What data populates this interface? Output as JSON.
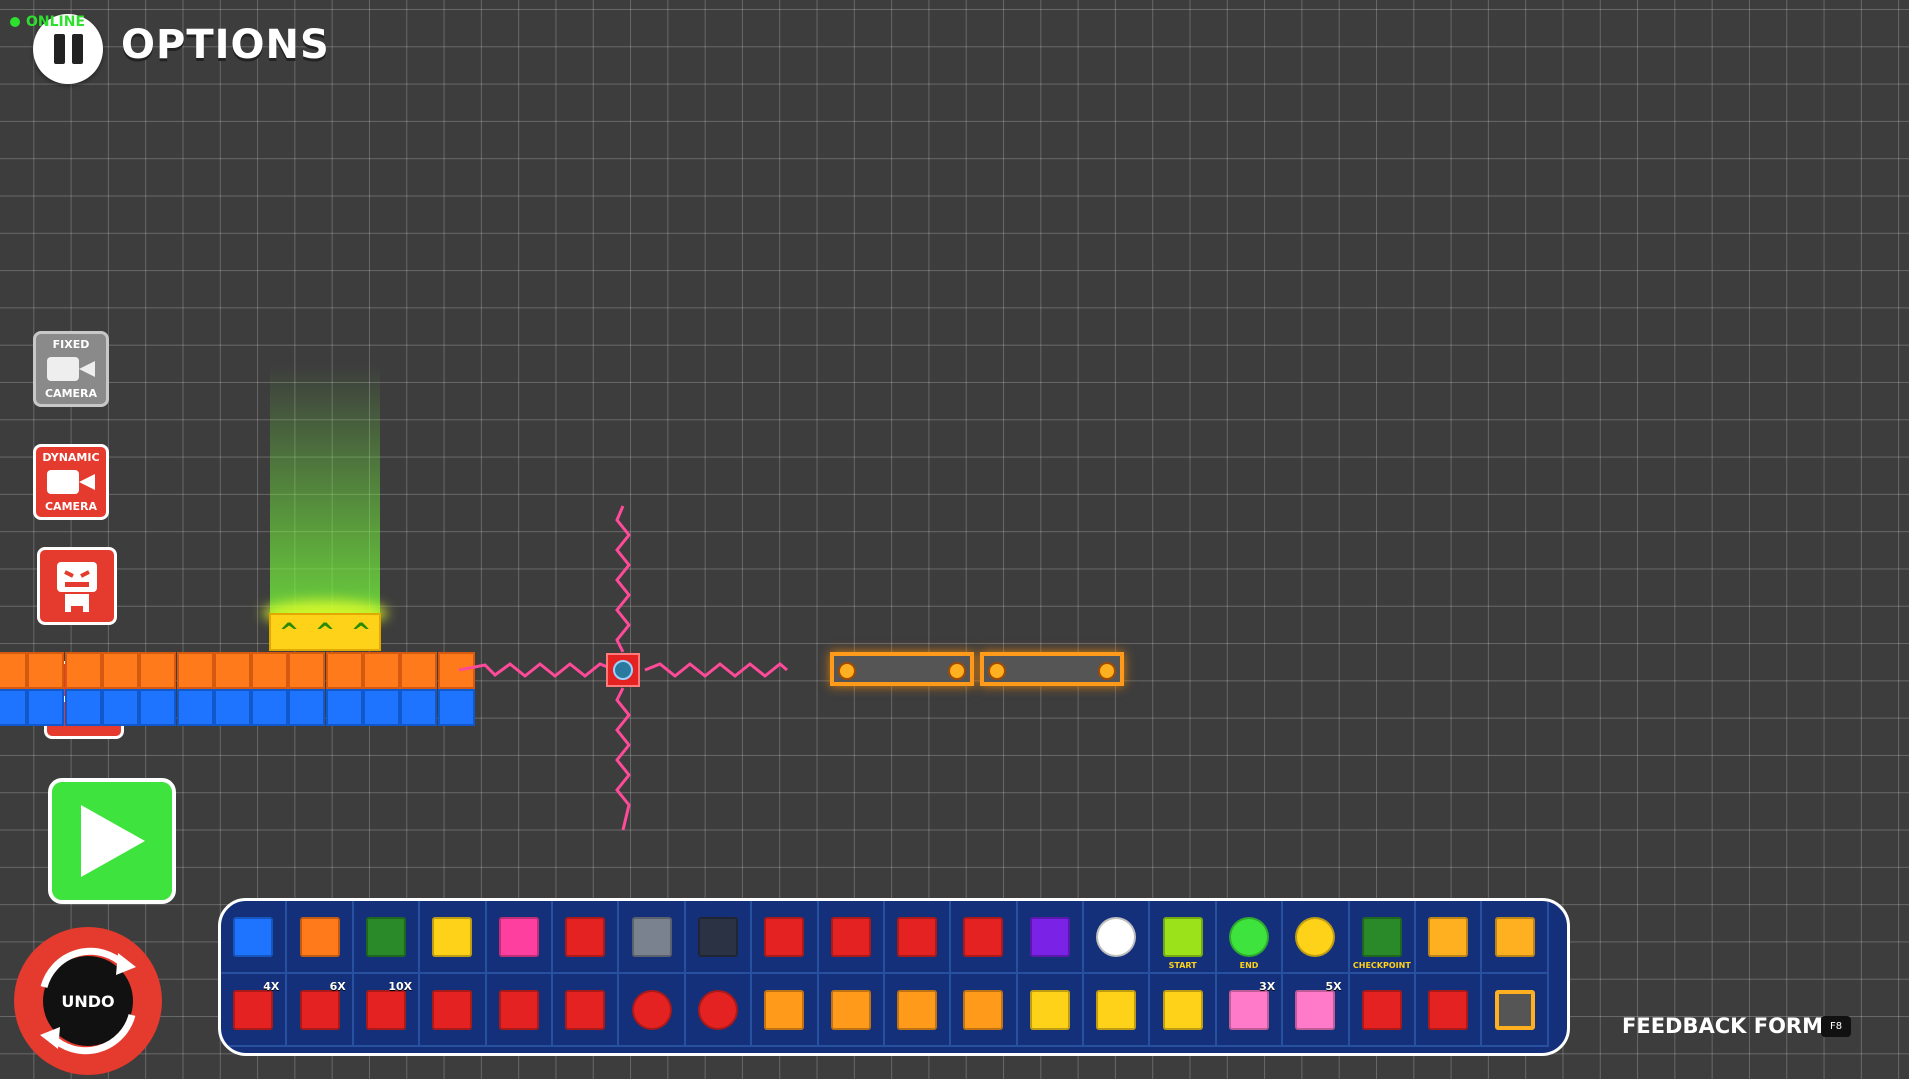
{
  "status": {
    "online_label": "ONLINE"
  },
  "header": {
    "options_label": "OPTIONS"
  },
  "camera": {
    "fixed_top": "FIXED",
    "fixed_bottom": "CAMERA",
    "dynamic_top": "DYNAMIC",
    "dynamic_bottom": "CAMERA"
  },
  "controls": {
    "undo_label": "UNDO"
  },
  "palette": {
    "row1": [
      {
        "icon": "blue-block",
        "color": "#1e74ff"
      },
      {
        "icon": "orange-block",
        "color": "#ff7a1a"
      },
      {
        "icon": "green-ladder-block",
        "color": "#2a8a2a"
      },
      {
        "icon": "yellow-block",
        "color": "#ffd21a"
      },
      {
        "icon": "pink-block",
        "color": "#ff3fa0"
      },
      {
        "icon": "red-block",
        "color": "#e52222"
      },
      {
        "icon": "gray-block",
        "color": "#7a8290"
      },
      {
        "icon": "dark-block",
        "color": "#2a3244"
      },
      {
        "icon": "red-spike-top-block",
        "color": "#e52222"
      },
      {
        "icon": "red-spike-left-block",
        "color": "#e52222"
      },
      {
        "icon": "red-spike-right-block",
        "color": "#e52222"
      },
      {
        "icon": "red-spike-bottom-block",
        "color": "#e52222"
      },
      {
        "icon": "purple-signal-block",
        "color": "#7a22e5"
      },
      {
        "icon": "stopwatch-icon",
        "color": "#ffffff"
      },
      {
        "icon": "start-pad",
        "color": "#9be21a",
        "label": "START"
      },
      {
        "icon": "end-portal",
        "color": "#3ee33e",
        "label": "END"
      },
      {
        "icon": "coin",
        "color": "#ffd21a"
      },
      {
        "icon": "checkpoint-flag",
        "color": "#2a8a2a",
        "label": "CHECKPOINT"
      },
      {
        "icon": "horizontal-platform",
        "color": "#ffb020"
      },
      {
        "icon": "vertical-platform",
        "color": "#ffb020"
      }
    ],
    "row2": [
      {
        "icon": "red-row-4x",
        "color": "#e52222",
        "label": "4X"
      },
      {
        "icon": "red-row-6x",
        "color": "#e52222",
        "label": "6X"
      },
      {
        "icon": "red-row-10x",
        "color": "#e52222",
        "label": "10X"
      },
      {
        "icon": "robot-enemy",
        "color": "#e52222"
      },
      {
        "icon": "red-dice-horizontal",
        "color": "#e52222"
      },
      {
        "icon": "red-dice-vertical",
        "color": "#e52222"
      },
      {
        "icon": "red-ring-horizontal",
        "color": "#e52222"
      },
      {
        "icon": "red-ring-vertical",
        "color": "#e52222"
      },
      {
        "icon": "boost-up",
        "color": "#ff9a1a"
      },
      {
        "icon": "boost-left",
        "color": "#ff9a1a"
      },
      {
        "icon": "boost-right",
        "color": "#ff9a1a"
      },
      {
        "icon": "boost-down",
        "color": "#ff9a1a"
      },
      {
        "icon": "jump-pad",
        "color": "#ffd21a"
      },
      {
        "icon": "conveyor-left",
        "color": "#ffd21a"
      },
      {
        "icon": "conveyor-right",
        "color": "#ffd21a"
      },
      {
        "icon": "pink-dice-3x",
        "color": "#ff7ac8",
        "label": "3X"
      },
      {
        "icon": "pink-dice-5x",
        "color": "#ff7ac8",
        "label": "5X"
      },
      {
        "icon": "laser-cross",
        "color": "#e52222"
      },
      {
        "icon": "laser-horizontal",
        "color": "#e52222"
      },
      {
        "icon": "selected-frame-block",
        "color": "#555555"
      }
    ]
  },
  "footer": {
    "feedback_label": "FEEDBACK FORM",
    "feedback_key": "F8"
  }
}
